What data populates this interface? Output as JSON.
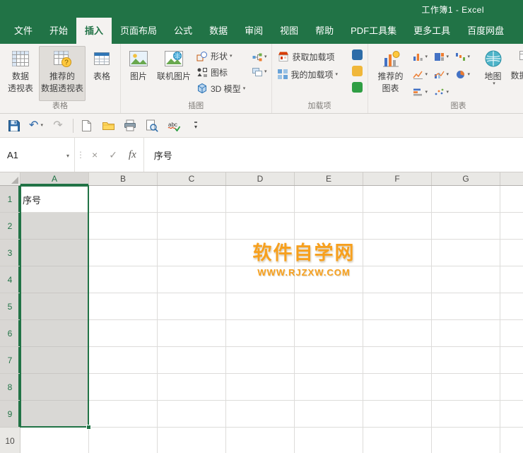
{
  "window": {
    "title": "工作簿1 - Excel"
  },
  "colors": {
    "excel_green": "#217346",
    "ribbon_bg": "#f4f2f0",
    "selection_fill": "#d9d8d5",
    "selection_border": "#217346",
    "watermark_orange": "#f7a01e",
    "addin_shortcut_colors": [
      "#2d6ca8",
      "#f0b73a",
      "#2f9e44"
    ]
  },
  "glyphs": {
    "dropdown": "▾",
    "undo": "↶",
    "redo": "↷",
    "cancel": "×",
    "enter": "✓",
    "fx": "fx",
    "handle": "⋮"
  },
  "quick_access": {
    "icons": [
      "save",
      "undo",
      "redo",
      "new-file",
      "open-folder",
      "print",
      "print-preview",
      "spelling-check",
      "customize-quick-access"
    ]
  },
  "tabs": {
    "file": "文件",
    "active": "插入",
    "items": [
      "开始",
      "插入",
      "页面布局",
      "公式",
      "数据",
      "审阅",
      "视图",
      "帮助",
      "PDF工具集",
      "更多工具",
      "百度网盘"
    ]
  },
  "ribbon": {
    "tables": {
      "label": "表格",
      "pivottable": {
        "l1": "数据",
        "l2": "透视表"
      },
      "recommended_pivottable": {
        "l1": "推荐的",
        "l2": "数据透视表"
      },
      "table": "表格"
    },
    "illustrations": {
      "label": "插图",
      "pictures": "图片",
      "online_pictures": "联机图片",
      "shapes": "形状",
      "icons": "图标",
      "model_3d": "3D 模型"
    },
    "addins": {
      "label": "加载项",
      "get_addins": "获取加载项",
      "my_addins": "我的加载项"
    },
    "charts": {
      "label": "图表",
      "recommended_charts": {
        "l1": "推荐的",
        "l2": "图表"
      },
      "maps": "地图",
      "pivotchart": "数据透视图"
    }
  },
  "formula_bar": {
    "name_box": "A1",
    "value": "序号"
  },
  "sheet": {
    "columns": [
      "A",
      "B",
      "C",
      "D",
      "E",
      "F",
      "G"
    ],
    "rows": [
      "1",
      "2",
      "3",
      "4",
      "5",
      "6",
      "7",
      "8",
      "9",
      "10"
    ],
    "cells": {
      "A1": "序号"
    },
    "selection": "A1:A9"
  },
  "watermark": {
    "title": "软件自学网",
    "url": "WWW.RJZXW.COM"
  }
}
